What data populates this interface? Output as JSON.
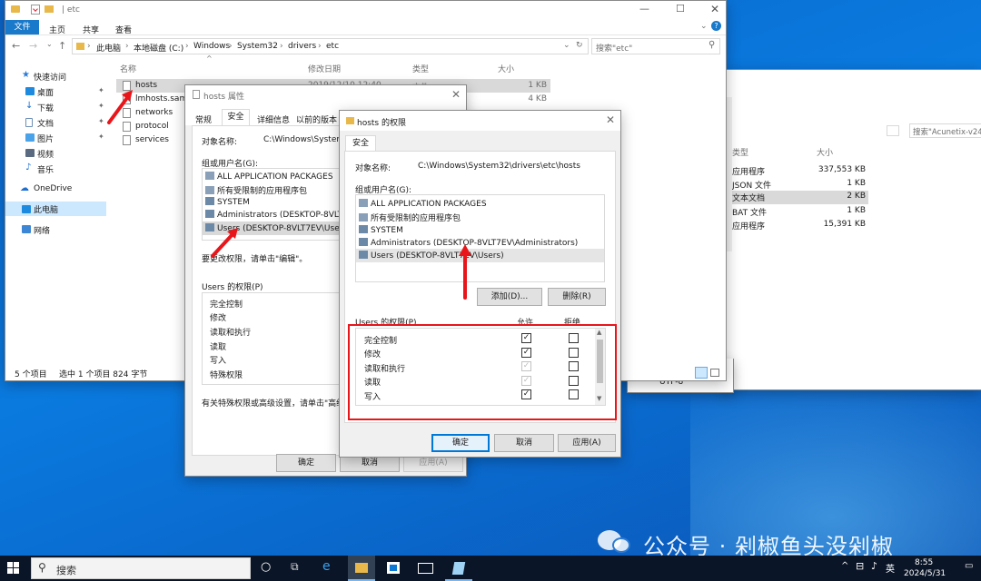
{
  "explorer": {
    "title": "etc",
    "ribbon_tabs": [
      "文件",
      "主页",
      "共享",
      "查看"
    ],
    "address": [
      "此电脑",
      "本地磁盘 (C:)",
      "Windows",
      "System32",
      "drivers",
      "etc"
    ],
    "search_placeholder": "搜索\"etc\"",
    "columns": [
      "名称",
      "修改日期",
      "类型",
      "大小"
    ],
    "files": [
      {
        "name": "hosts",
        "date": "2019/12/10 12:40",
        "type": "文件",
        "size": "1 KB"
      },
      {
        "name": "lmhosts.sam",
        "size": "4 KB"
      },
      {
        "name": "networks",
        "size": ""
      },
      {
        "name": "protocol",
        "size": ""
      },
      {
        "name": "services",
        "size": ""
      }
    ],
    "nav": [
      "快速访问",
      "桌面",
      "下载",
      "文档",
      "图片",
      "视频",
      "音乐",
      "OneDrive",
      "此电脑",
      "网络"
    ],
    "status_count": "5 个项目",
    "status_selected": "选中 1 个项目  824 字节"
  },
  "back_window": {
    "search_placeholder": "搜索\"Acunetix-v24",
    "col_type": "类型",
    "col_size": "大小",
    "rows": [
      {
        "type": "应用程序",
        "size": "337,553 KB"
      },
      {
        "type": "JSON 文件",
        "size": "1 KB"
      },
      {
        "type": "文本文档",
        "size": "2 KB"
      },
      {
        "type": "BAT 文件",
        "size": "1 KB"
      },
      {
        "type": "应用程序",
        "size": "15,391 KB"
      }
    ],
    "encoding": "UTF-8"
  },
  "props": {
    "title": "hosts 属性",
    "tabs": [
      "常规",
      "安全",
      "详细信息",
      "以前的版本"
    ],
    "object_label": "对象名称:",
    "object_value": "C:\\Windows\\System3",
    "group_label": "组或用户名(G):",
    "users": [
      "ALL APPLICATION PACKAGES",
      "所有受限制的应用程序包",
      "SYSTEM",
      "Administrators (DESKTOP-8VLT7E",
      "Users (DESKTOP-8VLT7EV\\Users)"
    ],
    "edit_hint": "要更改权限，请单击\"编辑\"。",
    "perm_label": "Users 的权限(P)",
    "perms": [
      "完全控制",
      "修改",
      "读取和执行",
      "读取",
      "写入",
      "特殊权限"
    ],
    "advanced_hint": "有关特殊权限或高级设置，请单击\"高级\"。",
    "ok": "确定",
    "cancel": "取消",
    "apply": "应用(A)"
  },
  "perm": {
    "title": "hosts 的权限",
    "tab": "安全",
    "object_label": "对象名称:",
    "object_value": "C:\\Windows\\System32\\drivers\\etc\\hosts",
    "group_label": "组或用户名(G):",
    "users": [
      "ALL APPLICATION PACKAGES",
      "所有受限制的应用程序包",
      "SYSTEM",
      "Administrators (DESKTOP-8VLT7EV\\Administrators)",
      "Users (DESKTOP-8VLT7EV\\Users)"
    ],
    "add": "添加(D)...",
    "remove": "删除(R)",
    "perm_label": "Users 的权限(P)",
    "allow": "允许",
    "deny": "拒绝",
    "perms": [
      {
        "name": "完全控制",
        "allow": true,
        "deny": false,
        "dim": false
      },
      {
        "name": "修改",
        "allow": true,
        "deny": false,
        "dim": false
      },
      {
        "name": "读取和执行",
        "allow": true,
        "deny": false,
        "dim": true
      },
      {
        "name": "读取",
        "allow": true,
        "deny": false,
        "dim": true
      },
      {
        "name": "写入",
        "allow": true,
        "deny": false,
        "dim": false
      }
    ],
    "ok": "确定",
    "cancel": "取消",
    "apply": "应用(A)"
  },
  "taskbar": {
    "search": "搜索",
    "lang": "英",
    "time": "8:55",
    "date": "2024/5/31"
  },
  "watermark": "公众号 · 剁椒鱼头没剁椒",
  "colors": {
    "accent": "#0078d7",
    "highlight": "#e8161b",
    "selection": "#cce8ff"
  }
}
